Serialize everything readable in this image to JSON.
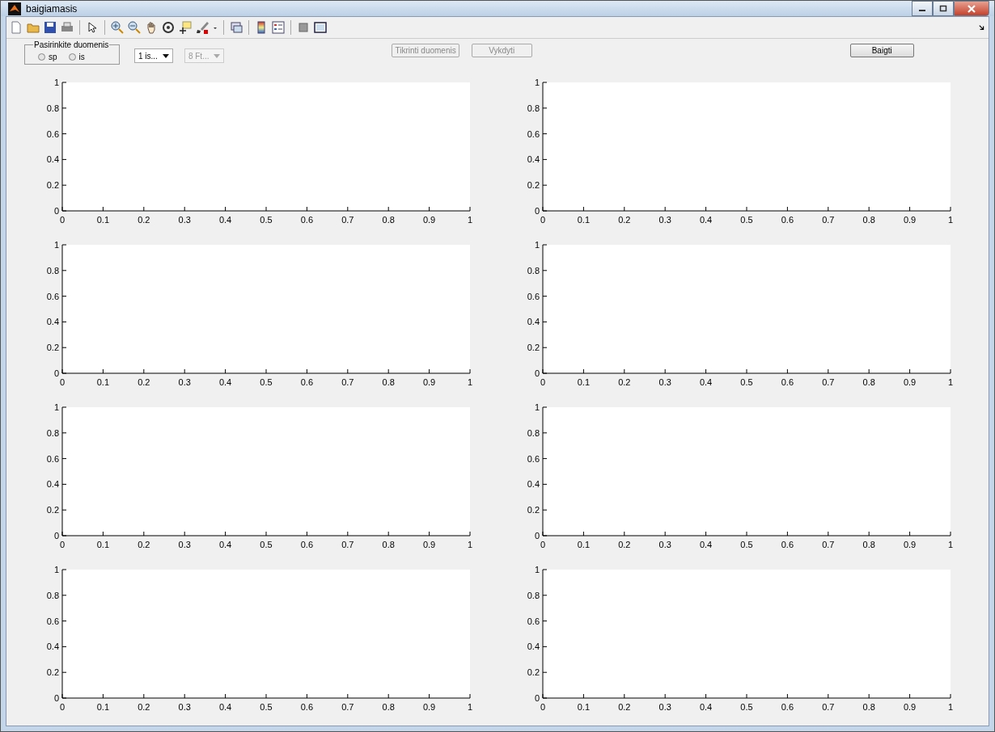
{
  "window": {
    "title": "baigiamasis"
  },
  "data_panel": {
    "title": "Pasirinkite duomenis",
    "options": [
      {
        "label": "sp",
        "selected": false
      },
      {
        "label": "is",
        "selected": false
      }
    ]
  },
  "dropdowns": [
    {
      "value": "1 is...",
      "disabled": false
    },
    {
      "value": "8 Ft...",
      "disabled": true
    }
  ],
  "buttons": [
    {
      "label": "Tikrinti duomenis",
      "disabled": true
    },
    {
      "label": "Vykdyti",
      "disabled": true
    },
    {
      "label": "Baigti",
      "disabled": false
    }
  ],
  "axes": [
    {
      "chart_data": {
        "type": "line",
        "xlim": [
          0,
          1
        ],
        "ylim": [
          0,
          1
        ],
        "xticks": [
          0,
          0.1,
          0.2,
          0.3,
          0.4,
          0.5,
          0.6,
          0.7,
          0.8,
          0.9,
          1
        ],
        "yticks": [
          0,
          0.2,
          0.4,
          0.6,
          0.8,
          1
        ]
      }
    },
    {
      "chart_data": {
        "type": "line",
        "xlim": [
          0,
          1
        ],
        "ylim": [
          0,
          1
        ],
        "xticks": [
          0,
          0.1,
          0.2,
          0.3,
          0.4,
          0.5,
          0.6,
          0.7,
          0.8,
          0.9,
          1
        ],
        "yticks": [
          0,
          0.2,
          0.4,
          0.6,
          0.8,
          1
        ]
      }
    },
    {
      "chart_data": {
        "type": "line",
        "xlim": [
          0,
          1
        ],
        "ylim": [
          0,
          1
        ],
        "xticks": [
          0,
          0.1,
          0.2,
          0.3,
          0.4,
          0.5,
          0.6,
          0.7,
          0.8,
          0.9,
          1
        ],
        "yticks": [
          0,
          0.2,
          0.4,
          0.6,
          0.8,
          1
        ]
      }
    },
    {
      "chart_data": {
        "type": "line",
        "xlim": [
          0,
          1
        ],
        "ylim": [
          0,
          1
        ],
        "xticks": [
          0,
          0.1,
          0.2,
          0.3,
          0.4,
          0.5,
          0.6,
          0.7,
          0.8,
          0.9,
          1
        ],
        "yticks": [
          0,
          0.2,
          0.4,
          0.6,
          0.8,
          1
        ]
      }
    },
    {
      "chart_data": {
        "type": "line",
        "xlim": [
          0,
          1
        ],
        "ylim": [
          0,
          1
        ],
        "xticks": [
          0,
          0.1,
          0.2,
          0.3,
          0.4,
          0.5,
          0.6,
          0.7,
          0.8,
          0.9,
          1
        ],
        "yticks": [
          0,
          0.2,
          0.4,
          0.6,
          0.8,
          1
        ]
      }
    },
    {
      "chart_data": {
        "type": "line",
        "xlim": [
          0,
          1
        ],
        "ylim": [
          0,
          1
        ],
        "xticks": [
          0,
          0.1,
          0.2,
          0.3,
          0.4,
          0.5,
          0.6,
          0.7,
          0.8,
          0.9,
          1
        ],
        "yticks": [
          0,
          0.2,
          0.4,
          0.6,
          0.8,
          1
        ]
      }
    },
    {
      "chart_data": {
        "type": "line",
        "xlim": [
          0,
          1
        ],
        "ylim": [
          0,
          1
        ],
        "xticks": [
          0,
          0.1,
          0.2,
          0.3,
          0.4,
          0.5,
          0.6,
          0.7,
          0.8,
          0.9,
          1
        ],
        "yticks": [
          0,
          0.2,
          0.4,
          0.6,
          0.8,
          1
        ]
      }
    },
    {
      "chart_data": {
        "type": "line",
        "xlim": [
          0,
          1
        ],
        "ylim": [
          0,
          1
        ],
        "xticks": [
          0,
          0.1,
          0.2,
          0.3,
          0.4,
          0.5,
          0.6,
          0.7,
          0.8,
          0.9,
          1
        ],
        "yticks": [
          0,
          0.2,
          0.4,
          0.6,
          0.8,
          1
        ]
      }
    }
  ]
}
